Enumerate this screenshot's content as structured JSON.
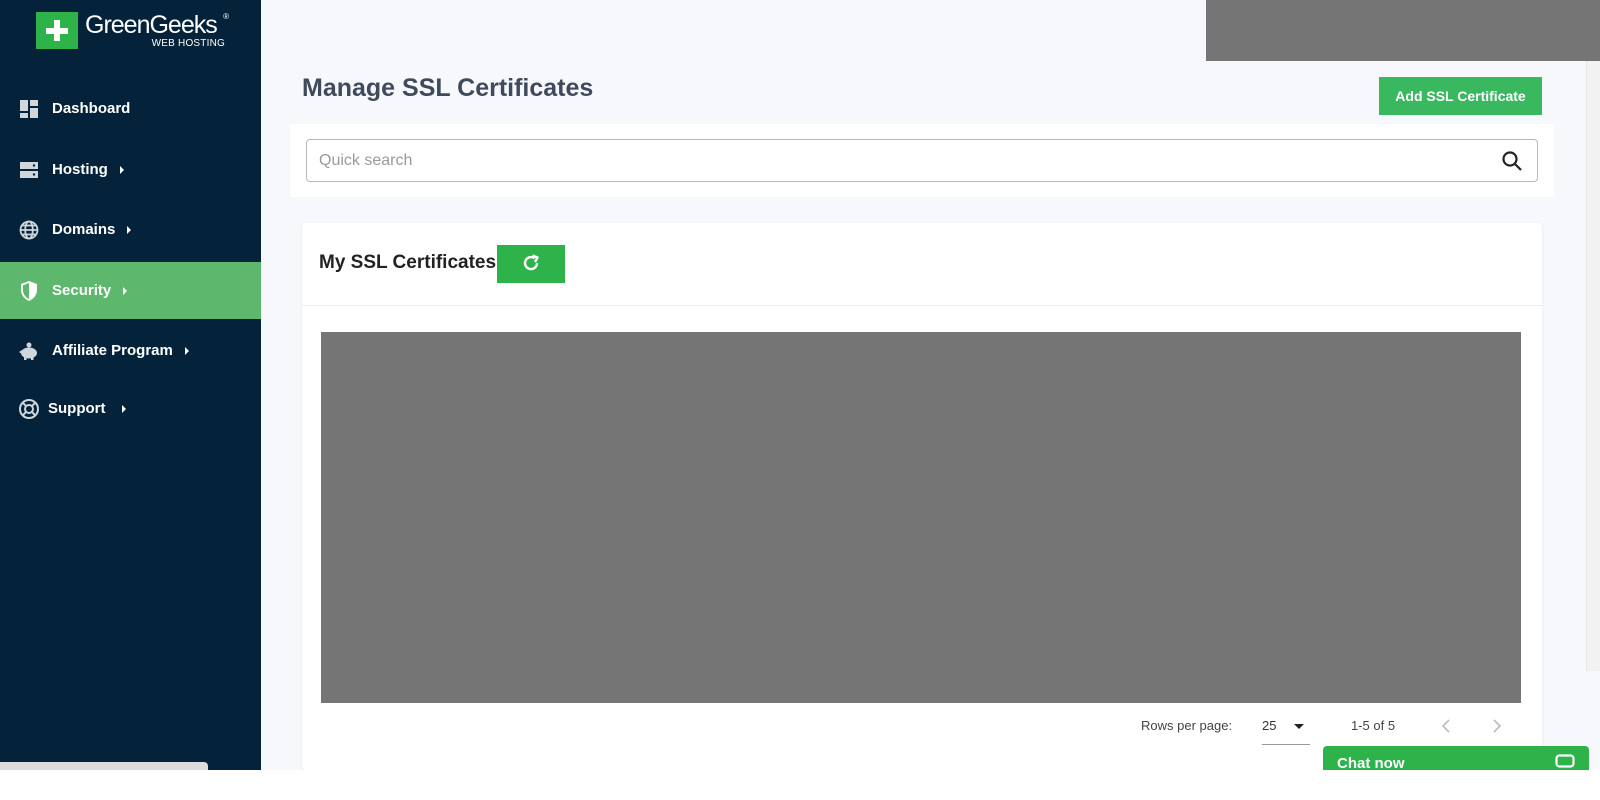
{
  "brand": {
    "name": "GreenGeeks",
    "sub": "WEB HOSTING",
    "registered": "®"
  },
  "sidebar": {
    "items": [
      {
        "label": "Dashboard",
        "icon": "dashboard-icon",
        "has_submenu": false
      },
      {
        "label": "Hosting",
        "icon": "server-icon",
        "has_submenu": true
      },
      {
        "label": "Domains",
        "icon": "globe-icon",
        "has_submenu": true
      },
      {
        "label": "Security",
        "icon": "shield-icon",
        "has_submenu": true,
        "active": true
      },
      {
        "label": "Affiliate Program",
        "icon": "piggy-bank-icon",
        "has_submenu": true
      },
      {
        "label": "Support",
        "icon": "lifebuoy-icon",
        "has_submenu": true
      }
    ]
  },
  "header": {
    "title": "Manage SSL Certificates",
    "add_button": "Add SSL Certificate"
  },
  "search": {
    "placeholder": "Quick search",
    "value": ""
  },
  "card": {
    "title": "My SSL Certificates"
  },
  "pagination": {
    "rows_label": "Rows per page:",
    "rows_value": "25",
    "range": "1-5 of 5"
  },
  "chat": {
    "label": "Chat now"
  },
  "colors": {
    "sidebar": "#04233a",
    "active": "#5db86d",
    "accent": "#2db34a",
    "title": "#3f4a5c"
  }
}
